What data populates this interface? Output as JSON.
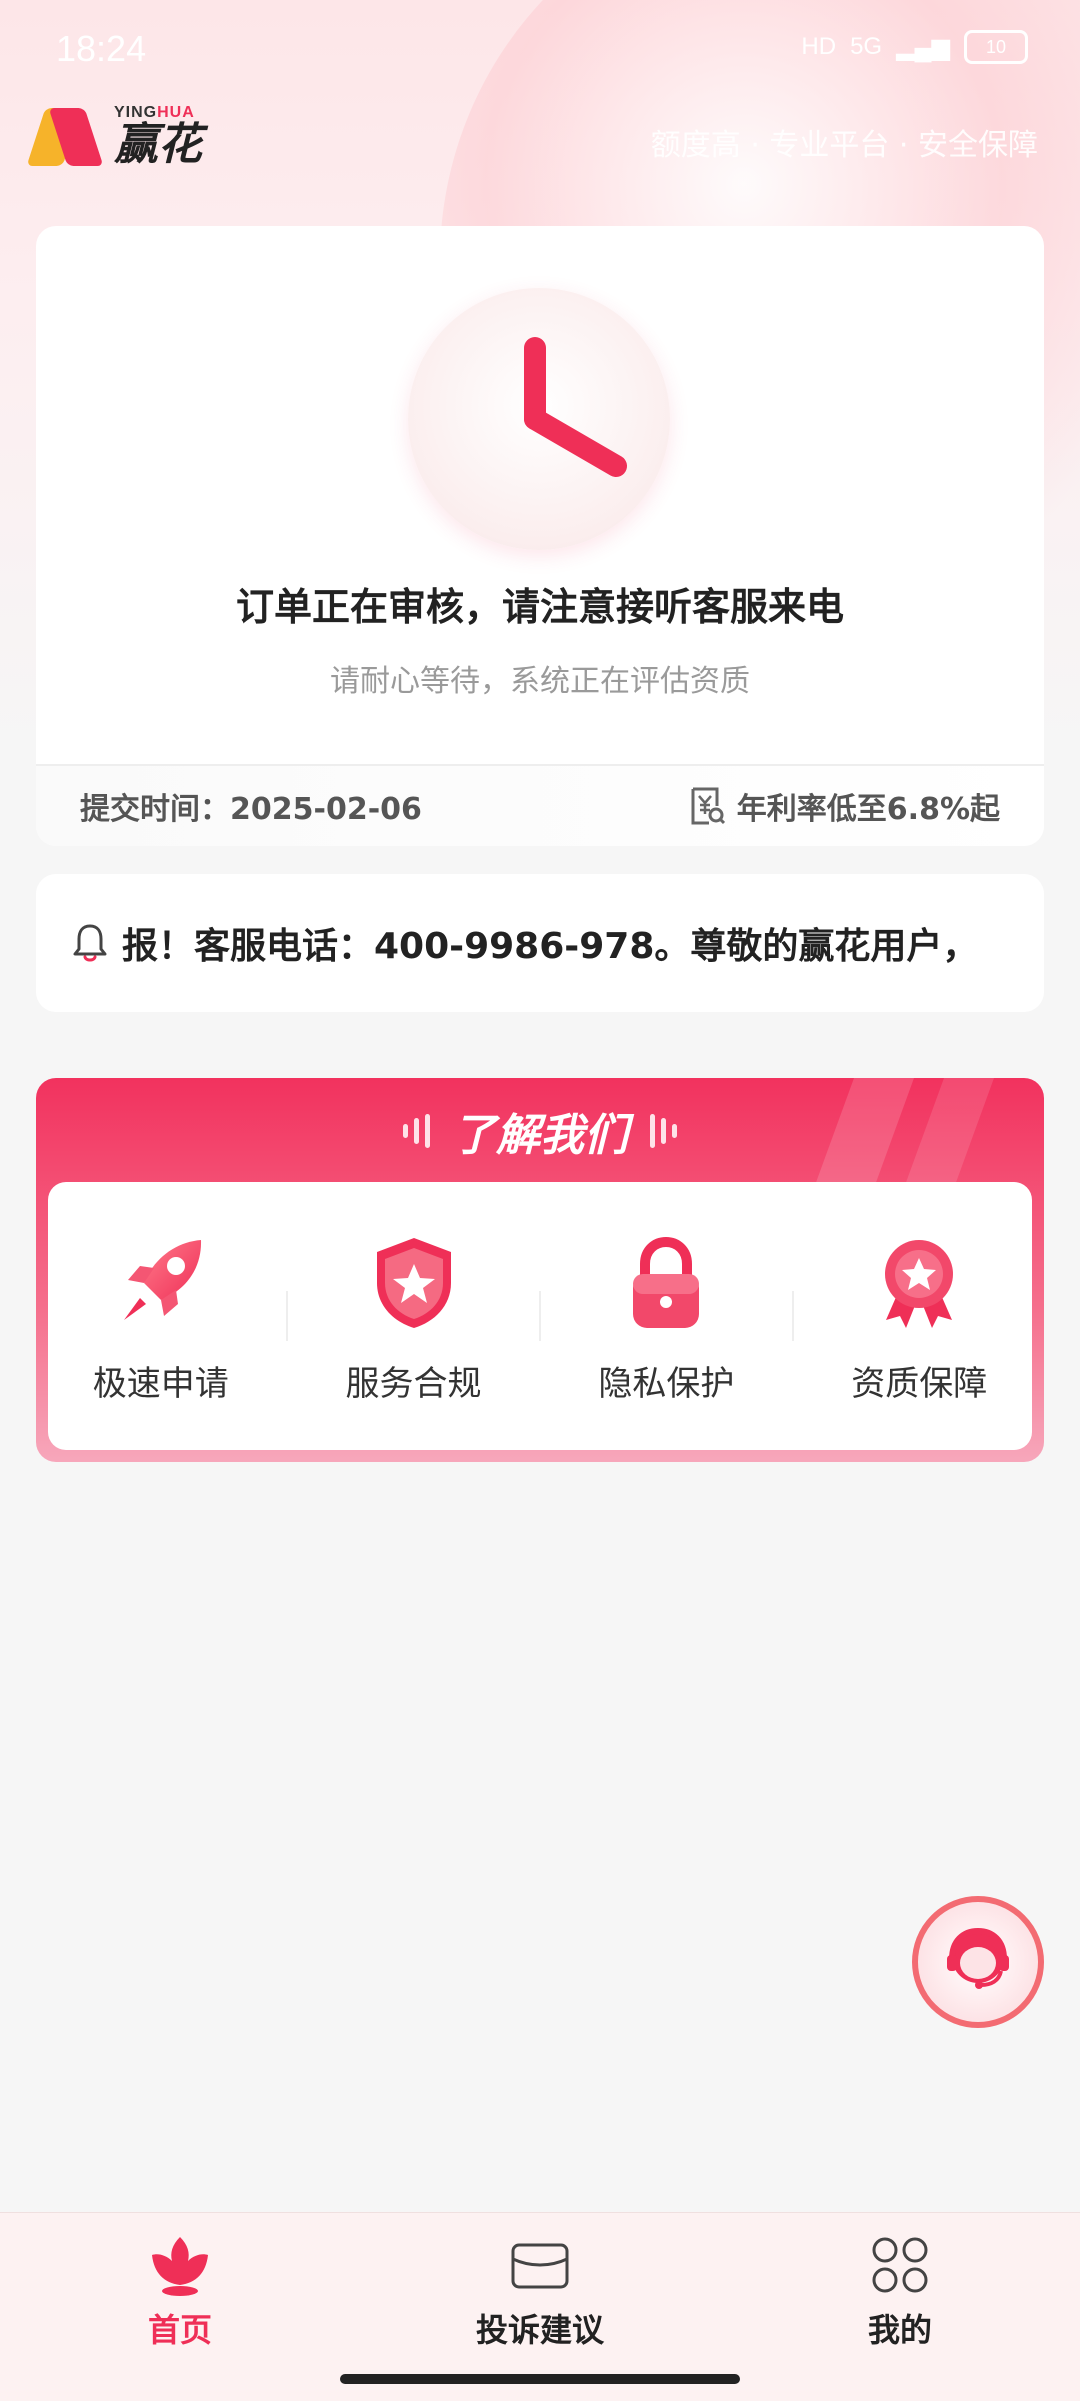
{
  "status_bar": {
    "time": "18:24",
    "network": "5G",
    "hd": "HD",
    "battery": "10"
  },
  "brand": {
    "name_en_left": "YING",
    "name_en_right": "HUA",
    "name_cn": "赢花",
    "slogan": "额度高 · 专业平台 · 安全保障"
  },
  "order": {
    "title": "订单正在审核，请注意接听客服来电",
    "subtitle": "请耐心等待，系统正在评估资质",
    "submit_time": "提交时间：2025-02-06",
    "rate": "年利率低至6.8%起"
  },
  "notice": {
    "text": "报！客服电话：400-9986-978。尊敬的赢花用户，"
  },
  "about": {
    "title": "了解我们",
    "features": [
      {
        "label": "极速申请",
        "icon": "rocket-icon"
      },
      {
        "label": "服务合规",
        "icon": "shield-star-icon"
      },
      {
        "label": "隐私保护",
        "icon": "lock-icon"
      },
      {
        "label": "资质保障",
        "icon": "medal-icon"
      }
    ]
  },
  "tabs": [
    {
      "label": "首页",
      "icon": "home-flower-icon",
      "active": true
    },
    {
      "label": "投诉建议",
      "icon": "mail-icon",
      "active": false
    },
    {
      "label": "我的",
      "icon": "grid-clover-icon",
      "active": false
    }
  ],
  "colors": {
    "accent": "#ef2f57",
    "brand_yellow": "#f6b32a",
    "background": "#f6f6f6"
  }
}
